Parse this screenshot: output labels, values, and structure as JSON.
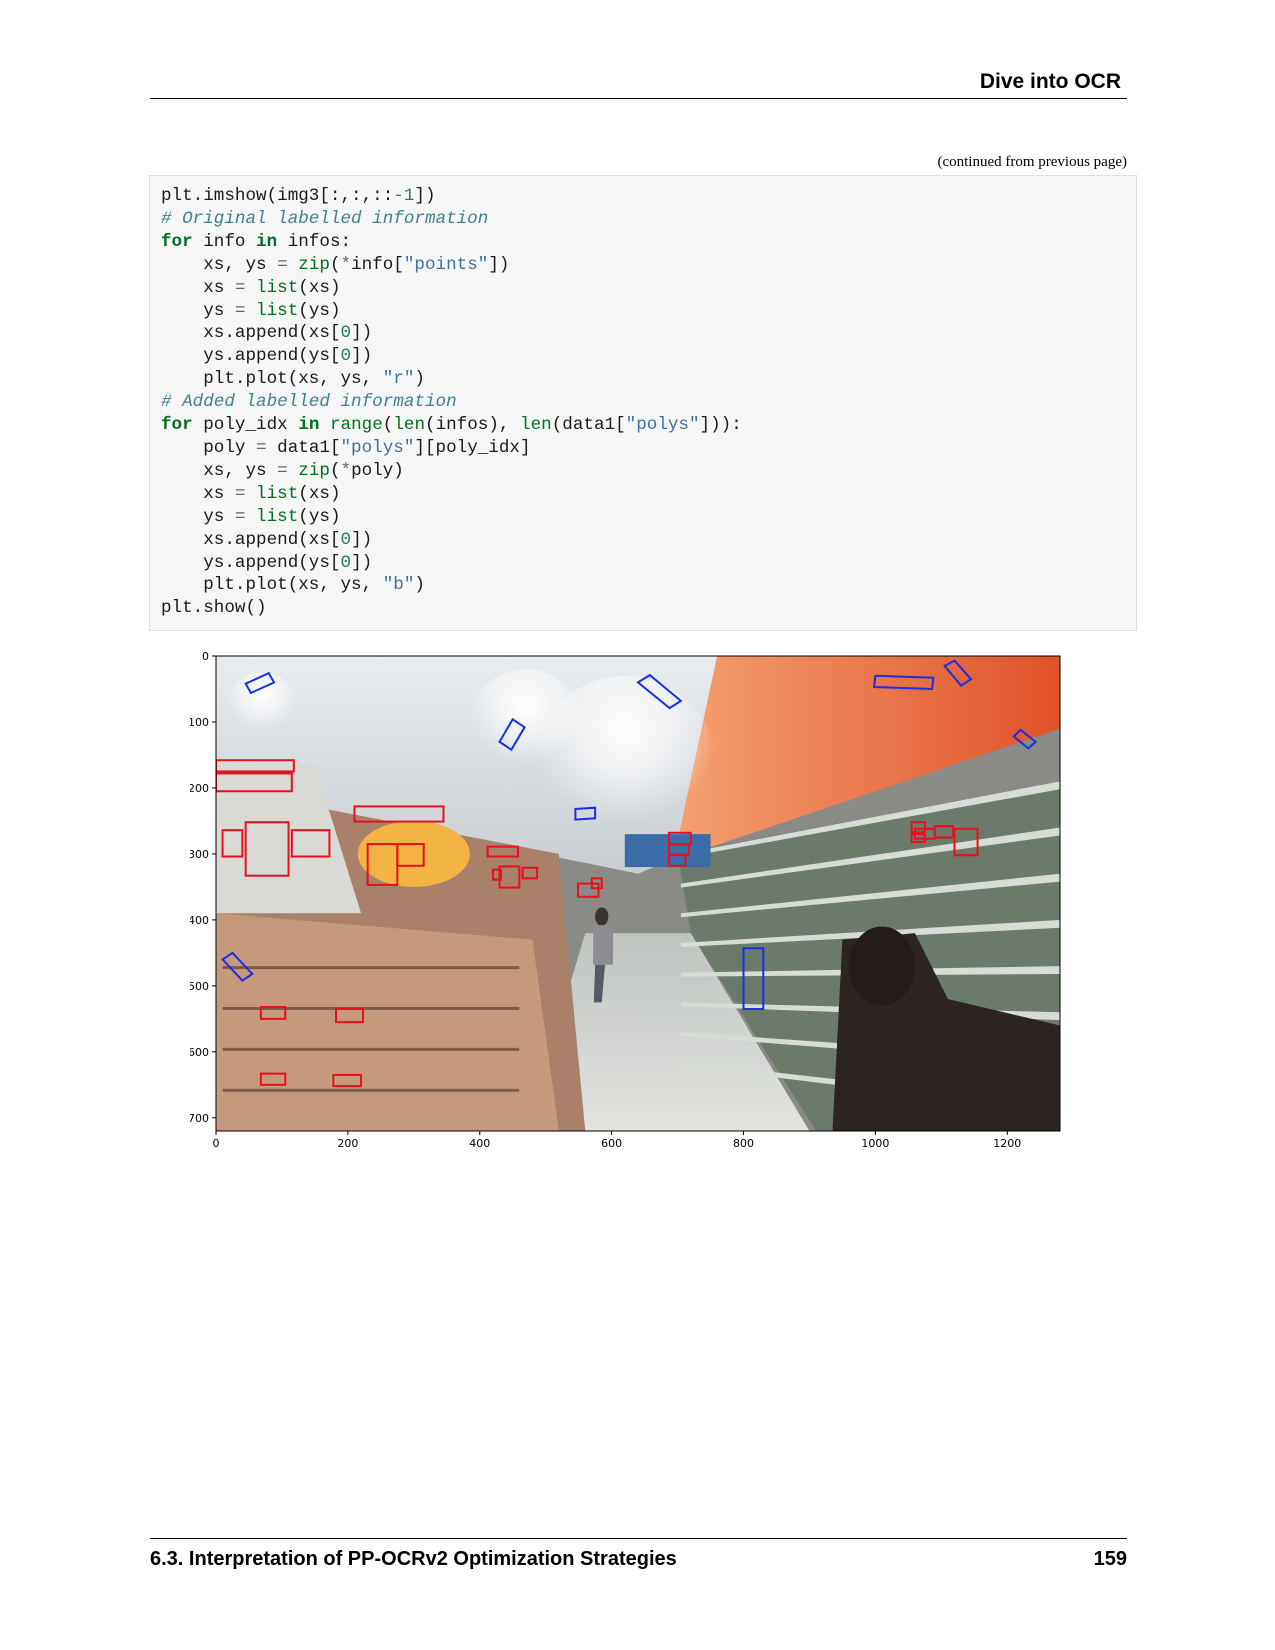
{
  "header": {
    "title": "Dive into OCR"
  },
  "continued_note": "(continued from previous page)",
  "code_lines": [
    [
      [
        "",
        "plt.imshow(img3[:,:,::"
      ],
      [
        "nm",
        "-1"
      ],
      [
        "",
        "])"
      ]
    ],
    [
      [
        "cm",
        "# Original labelled information"
      ]
    ],
    [
      [
        "kw",
        "for"
      ],
      [
        "",
        " info "
      ],
      [
        "kw",
        "in"
      ],
      [
        "",
        " infos:"
      ]
    ],
    [
      [
        "",
        "    xs, ys "
      ],
      [
        "op",
        "="
      ],
      [
        "",
        " "
      ],
      [
        "bi",
        "zip"
      ],
      [
        "",
        "("
      ],
      [
        "op",
        "*"
      ],
      [
        "",
        "info["
      ],
      [
        "st",
        "\"points\""
      ],
      [
        "",
        "])"
      ]
    ],
    [
      [
        "",
        "    xs "
      ],
      [
        "op",
        "="
      ],
      [
        "",
        " "
      ],
      [
        "bi",
        "list"
      ],
      [
        "",
        "(xs)"
      ]
    ],
    [
      [
        "",
        "    ys "
      ],
      [
        "op",
        "="
      ],
      [
        "",
        " "
      ],
      [
        "bi",
        "list"
      ],
      [
        "",
        "(ys)"
      ]
    ],
    [
      [
        "",
        "    xs.append(xs["
      ],
      [
        "nm",
        "0"
      ],
      [
        "",
        "])"
      ]
    ],
    [
      [
        "",
        "    ys.append(ys["
      ],
      [
        "nm",
        "0"
      ],
      [
        "",
        "])"
      ]
    ],
    [
      [
        "",
        "    plt.plot(xs, ys, "
      ],
      [
        "st",
        "\"r\""
      ],
      [
        "",
        ")"
      ]
    ],
    [
      [
        "cm",
        "# Added labelled information"
      ]
    ],
    [
      [
        "kw",
        "for"
      ],
      [
        "",
        " poly_idx "
      ],
      [
        "kw",
        "in"
      ],
      [
        "",
        " "
      ],
      [
        "bi",
        "range"
      ],
      [
        "",
        "("
      ],
      [
        "bi",
        "len"
      ],
      [
        "",
        "(infos), "
      ],
      [
        "bi",
        "len"
      ],
      [
        "",
        "(data1["
      ],
      [
        "st",
        "\"polys\""
      ],
      [
        "",
        "])):"
      ]
    ],
    [
      [
        "",
        "    poly "
      ],
      [
        "op",
        "="
      ],
      [
        "",
        " data1["
      ],
      [
        "st",
        "\"polys\""
      ],
      [
        "",
        "][poly_idx]"
      ]
    ],
    [
      [
        "",
        "    xs, ys "
      ],
      [
        "op",
        "="
      ],
      [
        "",
        " "
      ],
      [
        "bi",
        "zip"
      ],
      [
        "",
        "("
      ],
      [
        "op",
        "*"
      ],
      [
        "",
        "poly)"
      ]
    ],
    [
      [
        "",
        "    xs "
      ],
      [
        "op",
        "="
      ],
      [
        "",
        " "
      ],
      [
        "bi",
        "list"
      ],
      [
        "",
        "(xs)"
      ]
    ],
    [
      [
        "",
        "    ys "
      ],
      [
        "op",
        "="
      ],
      [
        "",
        " "
      ],
      [
        "bi",
        "list"
      ],
      [
        "",
        "(ys)"
      ]
    ],
    [
      [
        "",
        "    xs.append(xs["
      ],
      [
        "nm",
        "0"
      ],
      [
        "",
        "])"
      ]
    ],
    [
      [
        "",
        "    ys.append(ys["
      ],
      [
        "nm",
        "0"
      ],
      [
        "",
        "])"
      ]
    ],
    [
      [
        "",
        "    plt.plot(xs, ys, "
      ],
      [
        "st",
        "\"b\""
      ],
      [
        "",
        ")"
      ]
    ],
    [
      [
        "",
        "plt.show()"
      ]
    ]
  ],
  "chart_data": {
    "type": "image",
    "xlim": [
      0,
      1280
    ],
    "ylim": [
      720,
      0
    ],
    "x_ticks": [
      0,
      200,
      400,
      600,
      800,
      1000,
      1200
    ],
    "y_ticks": [
      0,
      100,
      200,
      300,
      400,
      500,
      600,
      700
    ],
    "red_boxes": [
      [
        0,
        158,
        118,
        175
      ],
      [
        0,
        178,
        115,
        205
      ],
      [
        10,
        264,
        40,
        304
      ],
      [
        45,
        252,
        110,
        333
      ],
      [
        115,
        264,
        172,
        304
      ],
      [
        210,
        228,
        345,
        251
      ],
      [
        230,
        285,
        275,
        347
      ],
      [
        275,
        285,
        315,
        318
      ],
      [
        412,
        289,
        458,
        304
      ],
      [
        420,
        324,
        432,
        339
      ],
      [
        430,
        319,
        460,
        351
      ],
      [
        465,
        321,
        487,
        337
      ],
      [
        549,
        345,
        580,
        365
      ],
      [
        570,
        337,
        585,
        352
      ],
      [
        687,
        268,
        720,
        285
      ],
      [
        687,
        286,
        717,
        301
      ],
      [
        687,
        302,
        712,
        318
      ],
      [
        1055,
        252,
        1075,
        267
      ],
      [
        1060,
        262,
        1090,
        277
      ],
      [
        1090,
        258,
        1118,
        275
      ],
      [
        1120,
        262,
        1155,
        302
      ],
      [
        1055,
        270,
        1075,
        282
      ],
      [
        68,
        532,
        105,
        550
      ],
      [
        182,
        535,
        223,
        555
      ],
      [
        68,
        633,
        105,
        650
      ],
      [
        178,
        635,
        220,
        652
      ]
    ],
    "blue_boxes": [
      [
        [
          45,
          42
        ],
        [
          80,
          26
        ],
        [
          88,
          40
        ],
        [
          53,
          56
        ]
      ],
      [
        [
          640,
          40
        ],
        [
          658,
          29
        ],
        [
          705,
          68
        ],
        [
          688,
          79
        ]
      ],
      [
        [
          1000,
          30
        ],
        [
          1088,
          33
        ],
        [
          1086,
          50
        ],
        [
          998,
          47
        ]
      ],
      [
        [
          1105,
          15
        ],
        [
          1120,
          7
        ],
        [
          1145,
          35
        ],
        [
          1130,
          45
        ]
      ],
      [
        [
          1210,
          122
        ],
        [
          1220,
          112
        ],
        [
          1243,
          130
        ],
        [
          1232,
          140
        ]
      ],
      [
        [
          430,
          130
        ],
        [
          450,
          96
        ],
        [
          468,
          108
        ],
        [
          448,
          142
        ]
      ],
      [
        [
          545,
          232
        ],
        [
          575,
          230
        ],
        [
          575,
          246
        ],
        [
          545,
          248
        ]
      ],
      [
        [
          800,
          443
        ],
        [
          830,
          443
        ],
        [
          830,
          535
        ],
        [
          800,
          535
        ]
      ],
      [
        [
          10,
          460
        ],
        [
          25,
          450
        ],
        [
          55,
          482
        ],
        [
          40,
          492
        ]
      ]
    ]
  },
  "footer": {
    "section": "6.3.   Interpretation of PP-OCRv2 Optimization Strategies",
    "page": "159"
  },
  "colors": {
    "red_box": "#e8101a",
    "blue_box": "#1a2fe0",
    "code_bg": "#f6f6f6"
  }
}
